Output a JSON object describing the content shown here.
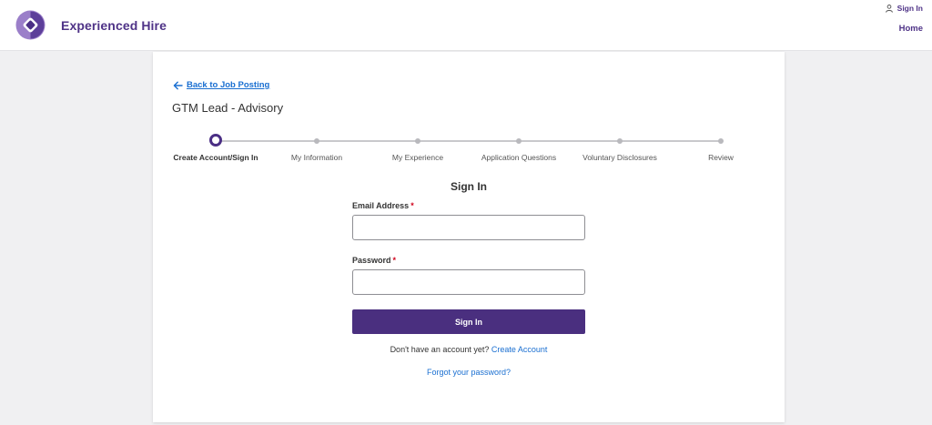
{
  "header": {
    "brand": "Experienced Hire",
    "sign_in": "Sign In",
    "home": "Home",
    "colors": {
      "brand": "#4f3387",
      "logo_light": "#9b7fc9",
      "logo_dark": "#4b2f85"
    }
  },
  "posting": {
    "back_label": "Back to Job Posting",
    "job_title": "GTM Lead - Advisory"
  },
  "steps": [
    {
      "label": "Create Account/Sign In",
      "active": true
    },
    {
      "label": "My Information",
      "active": false
    },
    {
      "label": "My Experience",
      "active": false
    },
    {
      "label": "Application Questions",
      "active": false
    },
    {
      "label": "Voluntary Disclosures",
      "active": false
    },
    {
      "label": "Review",
      "active": false
    }
  ],
  "form": {
    "title": "Sign In",
    "email_label": "Email Address",
    "password_label": "Password",
    "required_mark": "*",
    "email_value": "",
    "password_value": "",
    "submit_label": "Sign In",
    "no_account_text": "Don't have an account yet?",
    "create_account": "Create Account",
    "forgot_password": "Forgot your password?",
    "colors": {
      "button": "#4a2f7f",
      "link": "#1a6fd1",
      "required": "#d0021b"
    }
  }
}
